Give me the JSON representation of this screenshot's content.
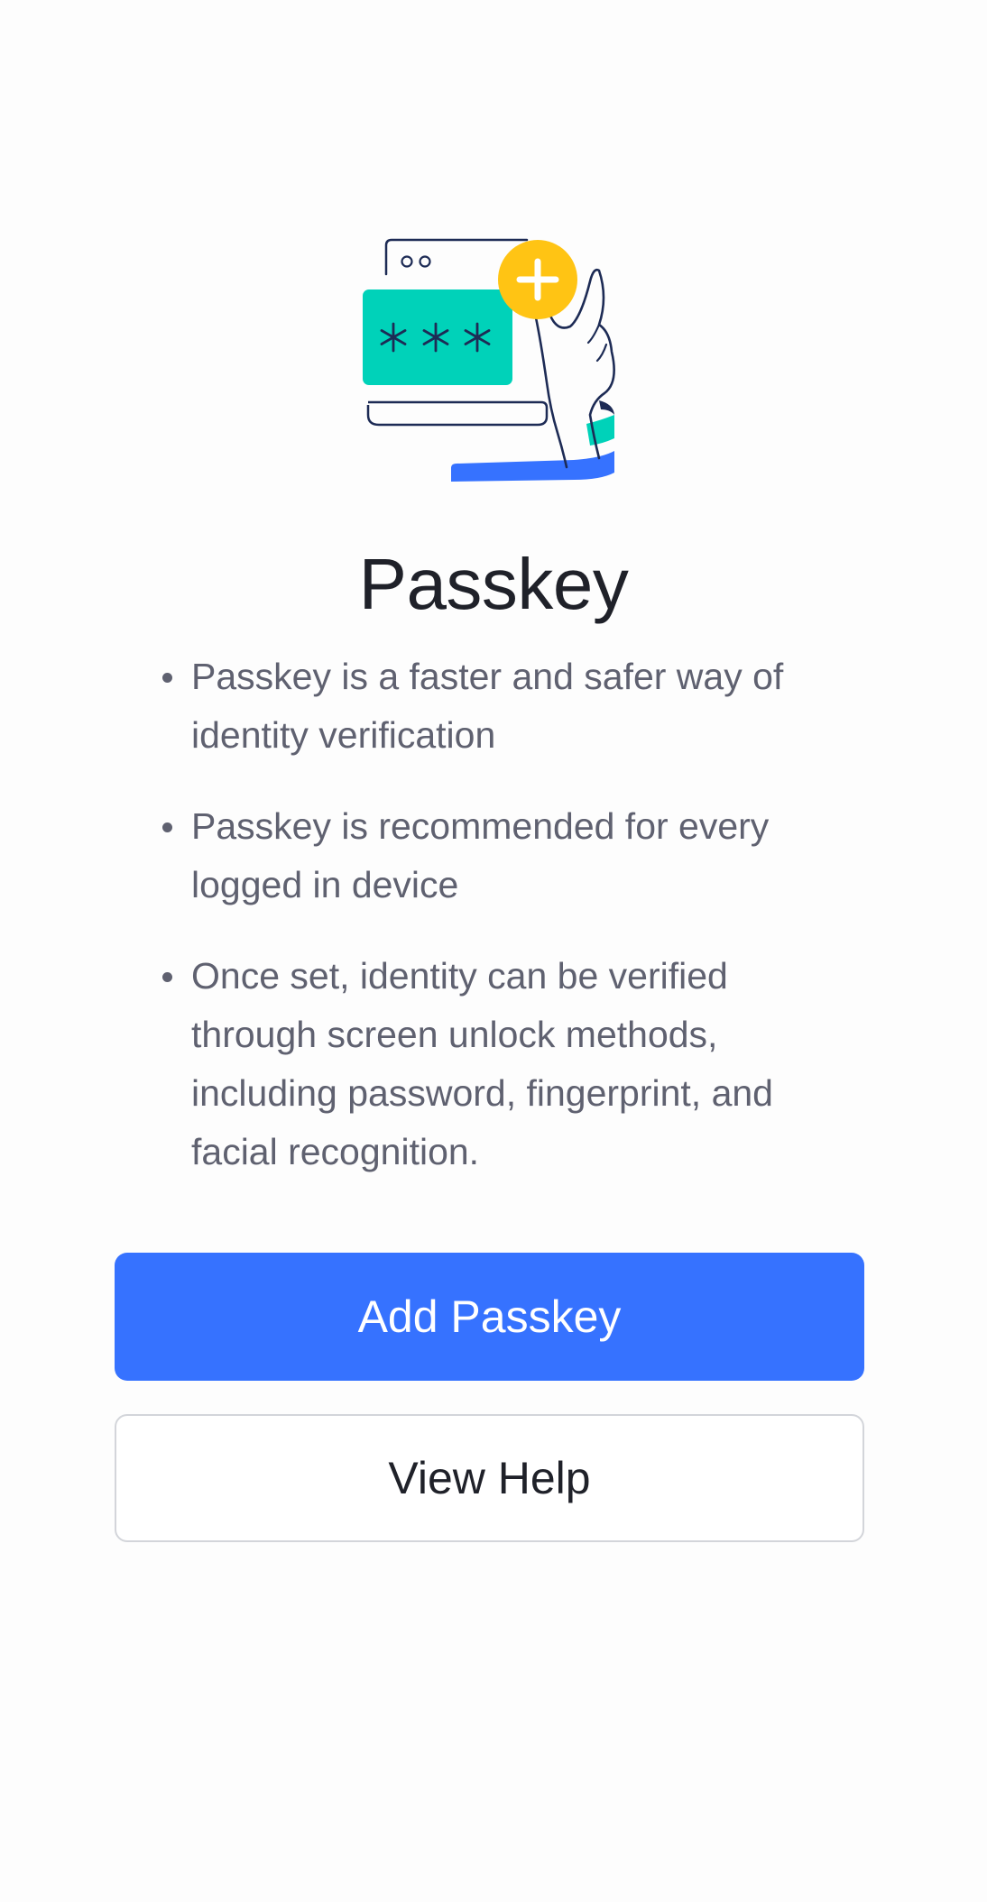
{
  "page": {
    "title": "Passkey"
  },
  "illustration": {
    "icon": "passkey-illustration-icon",
    "mask_text": "***",
    "colors": {
      "teal": "#00d2b9",
      "yellow": "#ffc414",
      "blue": "#3672ff",
      "navy": "#1d2b55"
    }
  },
  "bullets": [
    "Passkey is a faster and safer way of identity verification",
    "Passkey is recommended for every logged in device",
    "Once set, identity can be verified through screen unlock methods, including password, fingerprint, and facial recognition."
  ],
  "actions": {
    "add_label": "Add Passkey",
    "help_label": "View Help"
  },
  "colors": {
    "primary": "#3672ff",
    "title": "#1f2129",
    "body_text": "#5f6170",
    "border": "#d3d5da"
  }
}
